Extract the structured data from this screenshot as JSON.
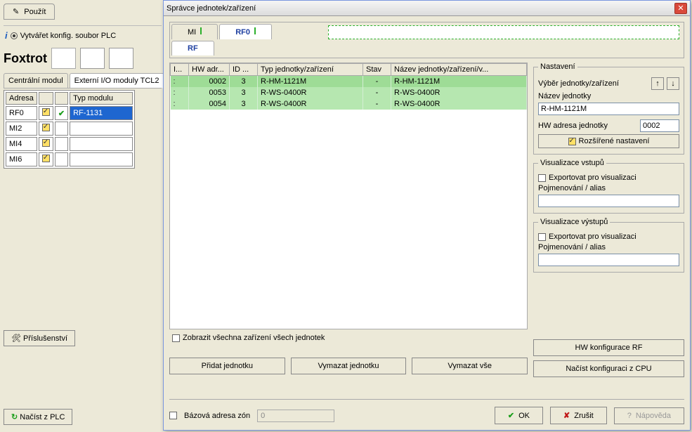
{
  "left": {
    "use_label": "Použít",
    "create_cfg_label": "Vytvářet konfig. soubor PLC",
    "product": "Foxtrot",
    "tabs": {
      "central": "Centrální modul",
      "ext": "Externí I/O moduly TCL2"
    },
    "cols": {
      "addr": "Adresa",
      "mod": "Typ modulu"
    },
    "rows": [
      {
        "addr": "RF0",
        "mod": "RF-1131",
        "sel": true,
        "check": true
      },
      {
        "addr": "MI2",
        "mod": ""
      },
      {
        "addr": "MI4",
        "mod": ""
      },
      {
        "addr": "MI6",
        "mod": ""
      }
    ],
    "accessories": "Příslušenství",
    "load_plc": "Načíst z PLC"
  },
  "dialog": {
    "title": "Správce jednotek/zařízení",
    "tabs": {
      "mi": "MI",
      "rf0": "RF0",
      "rf": "RF"
    },
    "grid_cols": {
      "i": "I...",
      "hw": "HW adr...",
      "id": "ID ...",
      "typ": "Typ jednotky/zařízení",
      "stav": "Stav",
      "nazev": "Název jednotky/zařízení/v..."
    },
    "rows": [
      {
        "i": ":",
        "hw": "0002",
        "id": "3",
        "typ": "R-HM-1121M",
        "stav": "-",
        "nazev": "R-HM-1121M",
        "sel": true
      },
      {
        "i": ":",
        "hw": "0053",
        "id": "3",
        "typ": "R-WS-0400R",
        "stav": "-",
        "nazev": "R-WS-0400R"
      },
      {
        "i": ":",
        "hw": "0054",
        "id": "3",
        "typ": "R-WS-0400R",
        "stav": "-",
        "nazev": "R-WS-0400R"
      }
    ],
    "show_all": "Zobrazit všechna zařízení všech jednotek",
    "buttons": {
      "add": "Přidat jednotku",
      "delete": "Vymazat jednotku",
      "delete_all": "Vymazat vše"
    },
    "side": {
      "settings": "Nastavení",
      "select_unit": "Výběr jednotky/zařízení",
      "unit_name": "Název jednotky",
      "unit_name_val": "R-HM-1121M",
      "hw_addr": "HW adresa jednotky",
      "hw_addr_val": "0002",
      "advanced": "Rozšířené nastavení",
      "viz_in": "Visualizace vstupů",
      "export_viz": "Exportovat pro visualizaci",
      "alias": "Pojmenování / alias",
      "viz_out": "Visualizace výstupů",
      "hw_cfg": "HW konfigurace RF",
      "load_cfg": "Načíst konfiguraci z CPU"
    },
    "bottom": {
      "zone": "Bázová adresa zón",
      "zone_val": "0",
      "ok": "OK",
      "cancel": "Zrušit",
      "help": "Nápověda"
    }
  }
}
